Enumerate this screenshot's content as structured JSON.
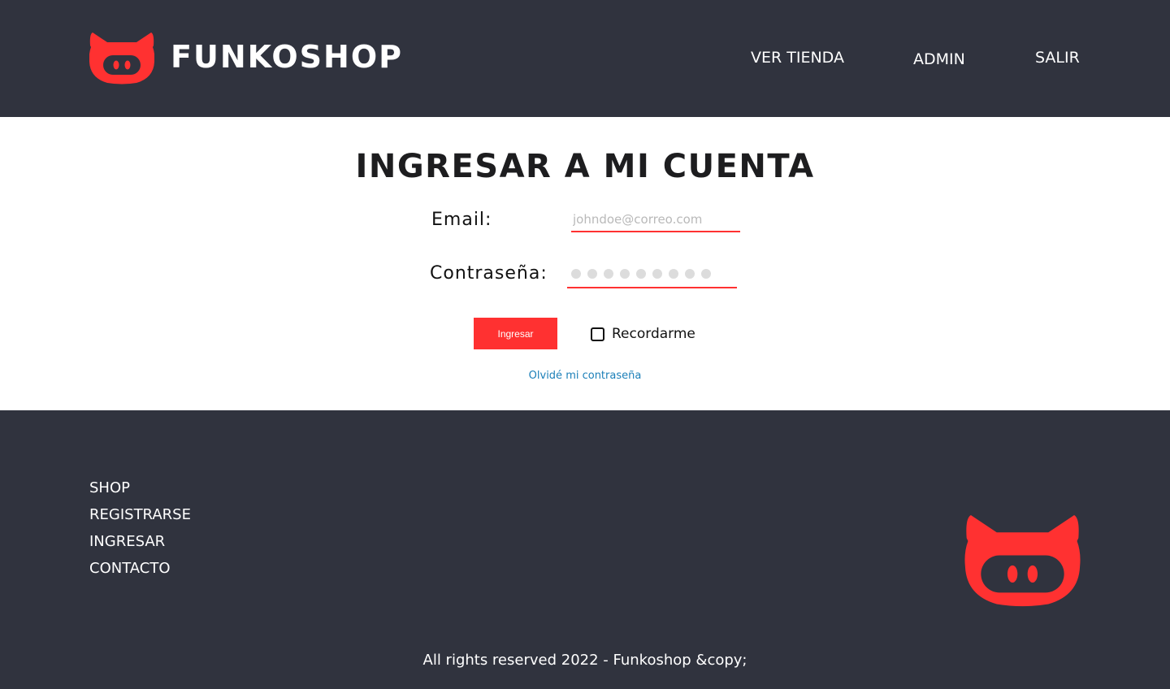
{
  "colors": {
    "brand": "#ff3131",
    "dark": "#30333e",
    "link": "#1b7fb8"
  },
  "header": {
    "logo_text": "FUNKOSHOP",
    "logo_icon": "cat-pig-icon",
    "nav": {
      "ver_tienda": "VER TIENDA",
      "admin": "ADMIN",
      "salir": "SALIR"
    }
  },
  "login": {
    "title": "INGRESAR A MI CUENTA",
    "email_label": "Email:",
    "email_placeholder": "johndoe@correo.com",
    "password_label": "Contraseña:",
    "submit_label": "Ingresar",
    "remember_label": "Recordarme",
    "forgot_label": "Olvidé mi contraseña"
  },
  "footer": {
    "links": [
      "SHOP",
      "REGISTRARSE",
      "INGRESAR",
      "CONTACTO"
    ],
    "logo_icon": "cat-pig-icon",
    "copyright": "All rights reserved 2022 - Funkoshop &copy;"
  }
}
